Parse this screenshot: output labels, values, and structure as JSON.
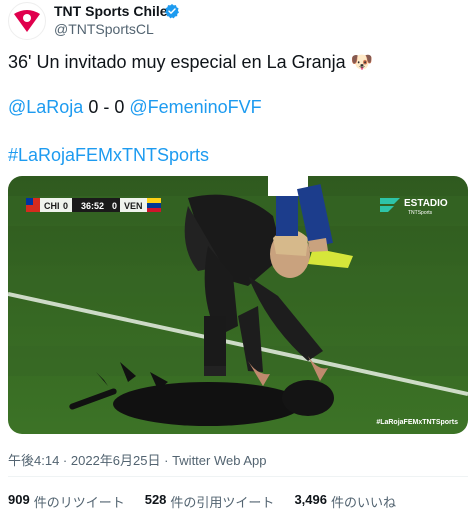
{
  "account": {
    "display_name": "TNT Sports Chile",
    "handle": "@TNTSportsCL",
    "verified": true,
    "avatar_icon": "tnt-sports-logo-icon",
    "brand_color": "#e0004d"
  },
  "tweet": {
    "text": "36' Un invitado muy especial en La Granja",
    "emoji": "🐶",
    "score": {
      "team1": "@LaRoja",
      "score": " 0 - 0 ",
      "team2": "@FemeninoFVF"
    },
    "hashtag": "#LaRojaFEMxTNTSports",
    "link_color": "#1d9bf0"
  },
  "media": {
    "scoreboard": {
      "team1": "CHI",
      "score1": "0",
      "clock": "36:52",
      "score2": "0",
      "team2": "VEN"
    },
    "channel": "ESTADIO",
    "channel_sub": "TNTSports",
    "watermark": "#LaRojaFEMxTNTSports"
  },
  "meta": {
    "time": "午後4:14",
    "separator1": " · ",
    "date": "2022年6月25日",
    "separator2": " · ",
    "source": "Twitter Web App"
  },
  "stats": [
    {
      "count": "909",
      "label": "件のリツイート"
    },
    {
      "count": "528",
      "label": "件の引用ツイート"
    },
    {
      "count": "3,496",
      "label": "件のいいね"
    }
  ]
}
